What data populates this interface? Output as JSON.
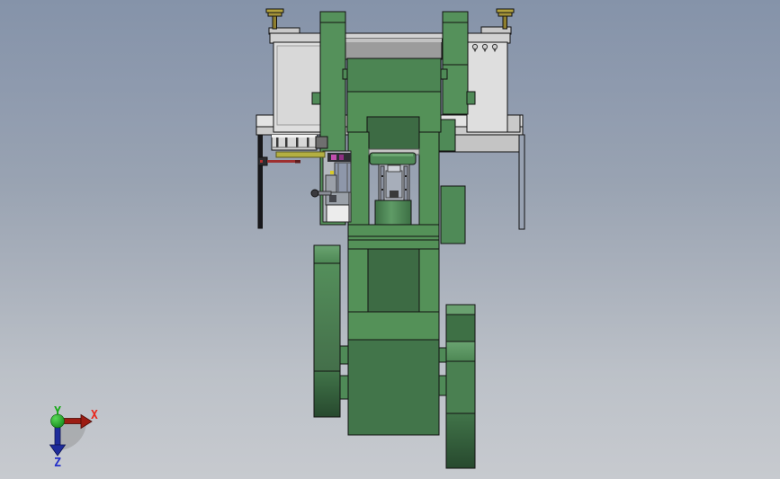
{
  "viewport": {
    "background_top": "#8593a9",
    "background_bottom": "#c7cacf"
  },
  "triad": {
    "x": {
      "label": "X",
      "label_color": "#e8291f",
      "arrow_color": "#9c1c12"
    },
    "y": {
      "label": "Y",
      "label_color": "#16a916",
      "sphere_color": "#1d9e1d"
    },
    "z": {
      "label": "Z",
      "label_color": "#2531c9",
      "arrow_color": "#1e2c9b"
    }
  },
  "model": {
    "palette": {
      "machine_green": "#549158",
      "machine_green_upper": "#4c8553",
      "machine_green_dark": "#3d6b44",
      "machine_green_deep": "#2e5636",
      "body_bottom_green": "#42754a",
      "frame_gray_light": "#dedede",
      "frame_gray_mid": "#9c9c9c",
      "beam_gray": "#c9c9c9",
      "screw_gold": "#b3a23c",
      "sensor_strip_yellow": "#b3af42",
      "rod_red": "#9e2f2f",
      "connector_magenta": "#b83fa0",
      "slide_blue_gray": "#8e97aa",
      "outline": "#121212"
    }
  }
}
